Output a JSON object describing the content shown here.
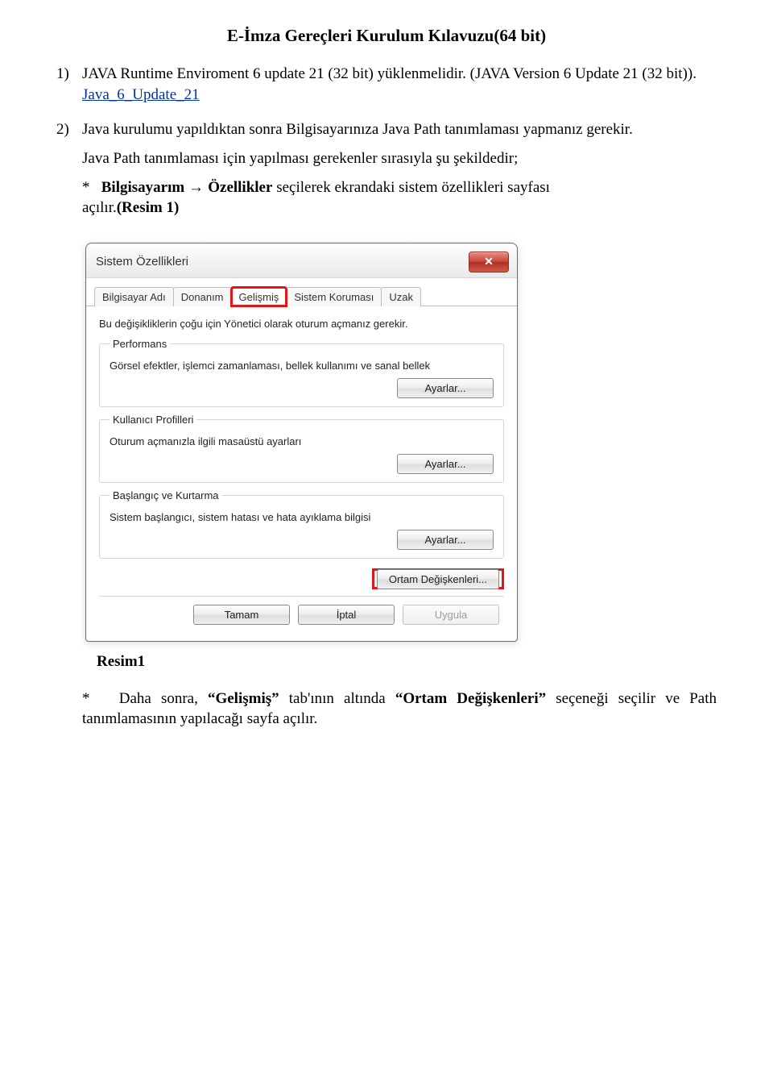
{
  "title": "E-İmza Gereçleri Kurulum Kılavuzu(64 bit)",
  "item1": {
    "num": "1)",
    "line1": "JAVA Runtime Enviroment 6 update 21 (32 bit) yüklenmelidir. (JAVA Version 6 Update 21 (32 bit)).",
    "link": "Java_6_Update_21"
  },
  "item2": {
    "num": "2)",
    "text": "Java kurulumu yapıldıktan sonra Bilgisayarınıza Java Path tanımlaması yapmanız gerekir."
  },
  "para2": "Java Path tanımlaması için yapılması gerekenler sırasıyla şu şekildedir;",
  "bullet": {
    "star": "*",
    "b1": "Bilgisayarım",
    "arrow": "→",
    "b2": "Özellikler",
    "rest": "seçilerek ekrandaki sistem özellikleri sayfası açılır.",
    "resim1": "(Resim 1)"
  },
  "dialog": {
    "title": "Sistem Özellikleri",
    "close": "✕",
    "tabs": {
      "t0": "Bilgisayar Adı",
      "t1": "Donanım",
      "t2": "Gelişmiş",
      "t3": "Sistem Koruması",
      "t4": "Uzak"
    },
    "hint": "Bu değişikliklerin çoğu için Yönetici olarak oturum açmanız gerekir.",
    "grp1": {
      "legend": "Performans",
      "desc": "Görsel efektler, işlemci zamanlaması, bellek kullanımı ve sanal bellek",
      "btn": "Ayarlar..."
    },
    "grp2": {
      "legend": "Kullanıcı Profilleri",
      "desc": "Oturum açmanızla ilgili masaüstü ayarları",
      "btn": "Ayarlar..."
    },
    "grp3": {
      "legend": "Başlangıç ve Kurtarma",
      "desc": "Sistem başlangıcı, sistem hatası ve hata ayıklama bilgisi",
      "btn": "Ayarlar..."
    },
    "envBtn": "Ortam Değişkenleri...",
    "ok": "Tamam",
    "cancel": "İptal",
    "apply": "Uygula"
  },
  "caption1": "Resim1",
  "bullet2": {
    "star": "*",
    "pre": "Daha sonra,",
    "q1": "“Gelişmiş”",
    "mid1": "tab'ının altında",
    "q2": "“Ortam Değişkenleri”",
    "mid2": "seçeneği seçilir ve Path tanımlamasının yapılacağı sayfa açılır."
  }
}
